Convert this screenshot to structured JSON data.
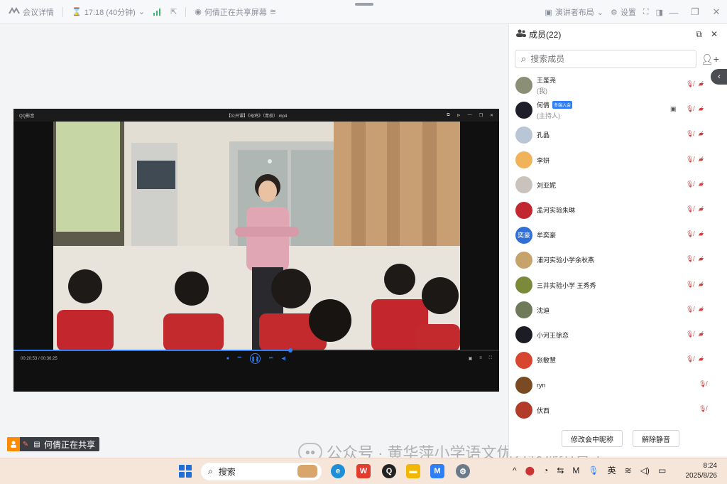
{
  "topbar": {
    "meeting_details": "会议详情",
    "timer": "17:18 (40分钟)",
    "sharing_status": "何倩正在共享屏幕",
    "layout_label": "演讲者布局",
    "settings_label": "设置"
  },
  "player": {
    "app_name": "QQ影音",
    "file_name": "【公开课】《母鸡》（青校）.mp4",
    "time_display": "00:20:53 / 00:36:25",
    "progress": 0.57
  },
  "share_badge": {
    "text": "何倩正在共享"
  },
  "sidebar": {
    "title": "成员(22)",
    "search_placeholder": "搜索成员",
    "members": [
      {
        "name": "王鉴尧",
        "sub": "(我)",
        "tag": "",
        "avatar_color": "#8a8f76",
        "avatar_text": "",
        "mic_muted": true,
        "cam_off": true,
        "sharing": false
      },
      {
        "name": "何倩",
        "sub": "(主持人)",
        "tag": "多端入会",
        "avatar_color": "#1e1e2a",
        "avatar_text": "",
        "mic_muted": true,
        "cam_off": true,
        "sharing": true
      },
      {
        "name": "孔晶",
        "sub": "",
        "tag": "",
        "avatar_color": "#b9c6d6",
        "avatar_text": "",
        "mic_muted": true,
        "cam_off": true,
        "sharing": false
      },
      {
        "name": "李妍",
        "sub": "",
        "tag": "",
        "avatar_color": "#f1b35a",
        "avatar_text": "",
        "mic_muted": true,
        "cam_off": true,
        "sharing": false
      },
      {
        "name": "刘亚妮",
        "sub": "",
        "tag": "",
        "avatar_color": "#c9c2bd",
        "avatar_text": "",
        "mic_muted": true,
        "cam_off": true,
        "sharing": false
      },
      {
        "name": "孟河实验朱琳",
        "sub": "",
        "tag": "",
        "avatar_color": "#c2262f",
        "avatar_text": "",
        "mic_muted": true,
        "cam_off": true,
        "sharing": false
      },
      {
        "name": "牟奕豪",
        "sub": "",
        "tag": "",
        "avatar_color": "#2f6fd6",
        "avatar_text": "奕豪",
        "mic_muted": true,
        "cam_off": true,
        "sharing": false
      },
      {
        "name": "浦河实验小学余秋燕",
        "sub": "",
        "tag": "",
        "avatar_color": "#c6a36a",
        "avatar_text": "",
        "mic_muted": true,
        "cam_off": true,
        "sharing": false
      },
      {
        "name": "三井实验小学 王秀秀",
        "sub": "",
        "tag": "",
        "avatar_color": "#7a8a3a",
        "avatar_text": "",
        "mic_muted": true,
        "cam_off": true,
        "sharing": false
      },
      {
        "name": "沈迪",
        "sub": "",
        "tag": "",
        "avatar_color": "#6f7a5a",
        "avatar_text": "",
        "mic_muted": true,
        "cam_off": true,
        "sharing": false
      },
      {
        "name": "小河王徐恋",
        "sub": "",
        "tag": "",
        "avatar_color": "#1c1c24",
        "avatar_text": "",
        "mic_muted": true,
        "cam_off": true,
        "sharing": false
      },
      {
        "name": "张敏慧",
        "sub": "",
        "tag": "",
        "avatar_color": "#d9462f",
        "avatar_text": "",
        "mic_muted": true,
        "cam_off": true,
        "sharing": false
      },
      {
        "name": "ryn",
        "sub": "",
        "tag": "",
        "avatar_color": "#7a4a22",
        "avatar_text": "",
        "mic_muted": true,
        "cam_off": false,
        "sharing": false
      },
      {
        "name": "伏西",
        "sub": "",
        "tag": "",
        "avatar_color": "#b33b2a",
        "avatar_text": "",
        "mic_muted": true,
        "cam_off": false,
        "sharing": false
      }
    ],
    "rename_button": "修改会中昵称",
    "unmute_button": "解除静音"
  },
  "watermark": {
    "text": "公众号 · 黄华萍小学语文优秀教师培育室"
  },
  "taskbar": {
    "search_label": "搜索",
    "ime_label": "英",
    "time": "8:24",
    "date": "2025/8/26"
  }
}
